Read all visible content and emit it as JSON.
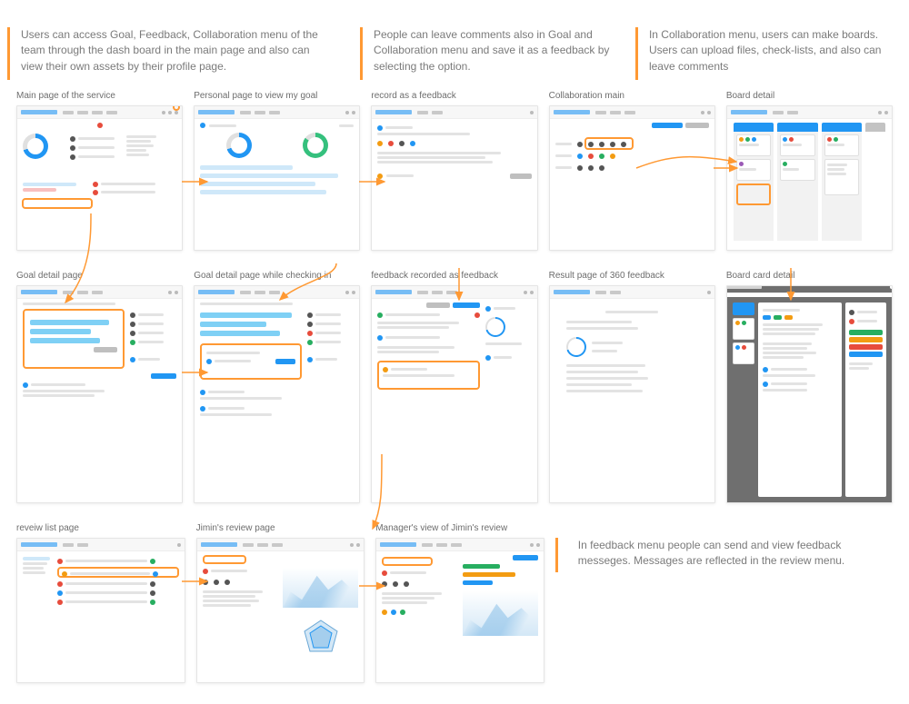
{
  "headers": {
    "h1": "Users can access Goal, Feedback, Collaboration menu of the team through the dash board in the main page and also can view their own assets by their profile page.",
    "h2": "People can leave comments also in Goal and Collaboration menu and save it as a feedback by selecting the option.",
    "h3": "In Collaboration menu, users can make boards. Users can upload files, check-lists, and also can leave comments"
  },
  "row1": {
    "c1": {
      "label": "Main page of the service"
    },
    "c2": {
      "label": "Personal page to view my goal"
    },
    "c3": {
      "label": "record as a feedback"
    },
    "c4": {
      "label": "Collaboration main"
    },
    "c5": {
      "label": "Board detail"
    }
  },
  "row2": {
    "c1": {
      "label": "Goal detail page"
    },
    "c2": {
      "label": "Goal detail page while checking in"
    },
    "c3": {
      "label": "feedback recorded as feedback"
    },
    "c4": {
      "label": "Result page of 360 feedback"
    },
    "c5": {
      "label": "Board card detail"
    }
  },
  "row3": {
    "c1": {
      "label": "reveiw list page"
    },
    "c2": {
      "label": "Jimin's review page"
    },
    "c3": {
      "label": "Manager's view of Jimin's review"
    }
  },
  "annot": {
    "a1": "In feedback menu people can send and view feedback messeges. Messages are reflected in the review menu."
  }
}
